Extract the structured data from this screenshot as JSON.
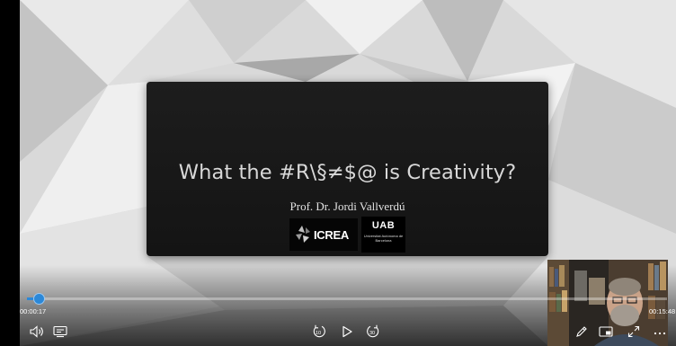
{
  "slide": {
    "title": "What the #R\\§≠$@ is Creativity?",
    "author": "Prof. Dr. Jordi Vallverdú",
    "logos": {
      "icrea": "ICREA",
      "uab_main": "UAB",
      "uab_sub": "Universitat Autònoma de Barcelona"
    }
  },
  "player": {
    "time_current": "00:00:17",
    "time_total": "00:15:48",
    "progress": 0.018,
    "accent_color": "#2b88d8",
    "skip_back_seconds": "10",
    "skip_forward_seconds": "30",
    "icons": {
      "volume": "volume-icon",
      "captions": "captions-icon",
      "skip_back": "skip-back-10-icon",
      "play": "play-icon",
      "skip_forward": "skip-forward-30-icon",
      "pen": "pen-icon",
      "picture_in_picture": "picture-in-picture-icon",
      "fullscreen": "fullscreen-icon",
      "more": "more-options-icon"
    }
  }
}
